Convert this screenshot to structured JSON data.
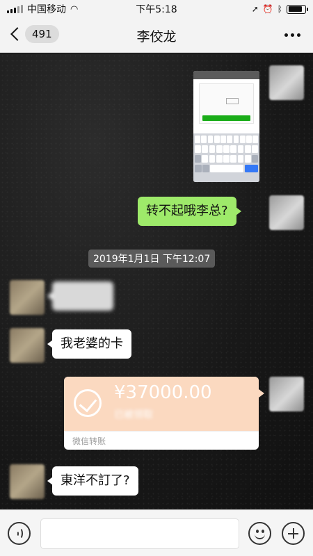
{
  "status_bar": {
    "carrier": "中国移动",
    "time": "下午5:18",
    "battery_level": 0.85
  },
  "nav": {
    "unread_count": "491",
    "title": "李佼龙"
  },
  "messages": {
    "timestamp": "2019年1月1日 下午12:07",
    "sent_text": "转不起哦李总?",
    "received_1": "",
    "received_2": "我老婆的卡",
    "received_3": "東洋不訂了?"
  },
  "transfer": {
    "amount": "¥37000.00",
    "status": "已被领取",
    "label": "微信转账"
  },
  "icons": {
    "back": "chevron-left-icon",
    "more": "more-dots-icon",
    "voice": "voice-icon",
    "emoji": "emoji-icon",
    "add": "plus-icon"
  }
}
